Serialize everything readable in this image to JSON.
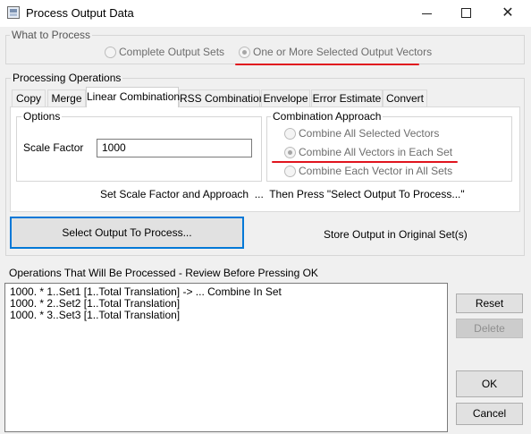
{
  "window": {
    "title": "Process Output Data",
    "close_glyph": "✕"
  },
  "what_to_process": {
    "label": "What to Process",
    "options": [
      {
        "label": "Complete Output Sets",
        "checked": false
      },
      {
        "label": "One or More Selected Output Vectors",
        "checked": true
      }
    ]
  },
  "processing_operations": {
    "label": "Processing Operations",
    "tabs": [
      "Copy",
      "Merge",
      "Linear Combination",
      "RSS Combination",
      "Envelope",
      "Error Estimate",
      "Convert"
    ],
    "active_tab": "Linear Combination"
  },
  "options_group": {
    "label": "Options",
    "scale_factor_label": "Scale Factor",
    "scale_factor_value": "1000"
  },
  "combination_approach": {
    "label": "Combination Approach",
    "options": [
      {
        "label": "Combine All Selected Vectors",
        "checked": false
      },
      {
        "label": "Combine All Vectors in Each Set",
        "checked": true
      },
      {
        "label": "Combine Each Vector in All Sets",
        "checked": false
      }
    ]
  },
  "instruction": "Set Scale Factor and Approach  ...  Then Press \"Select Output To Process...\"",
  "select_button": "Select Output To Process...",
  "store_output_label": "Store Output in Original Set(s)",
  "operations_label": "Operations That Will Be Processed - Review Before Pressing OK",
  "operations": [
    "1000. * 1..Set1 [1..Total Translation] -> ... Combine In Set",
    "1000. * 2..Set2 [1..Total Translation]",
    "1000. * 3..Set3 [1..Total Translation]"
  ],
  "buttons": {
    "reset": "Reset",
    "delete": "Delete",
    "ok": "OK",
    "cancel": "Cancel"
  },
  "colors": {
    "annotation": "#e0141e",
    "focus": "#0078d7"
  }
}
